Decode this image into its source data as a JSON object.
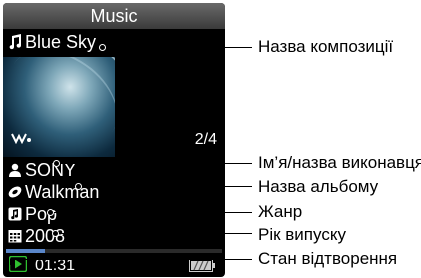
{
  "screen": {
    "title": "Music",
    "track": "Blue Sky",
    "track_counter": "2/4",
    "artist": "SONY",
    "album": "Walkman",
    "genre": "Pop",
    "year": "2008",
    "time": "01:31",
    "progress": 0.18
  },
  "callouts": {
    "track_title": "Назва композиції",
    "artist": "Ім’я/назва виконавця",
    "album": "Назва альбому",
    "genre": "Жанр",
    "year": "Рік випуску",
    "playback": "Стан відтворення"
  },
  "icons": {
    "track": "music-note-icon",
    "artist": "person-icon",
    "album": "disc-icon",
    "genre": "genre-icon",
    "year": "calendar-icon",
    "play": "play-icon",
    "battery": "battery-icon"
  },
  "colors": {
    "progress": "#5a86c9",
    "play": "#2fbf2f"
  }
}
